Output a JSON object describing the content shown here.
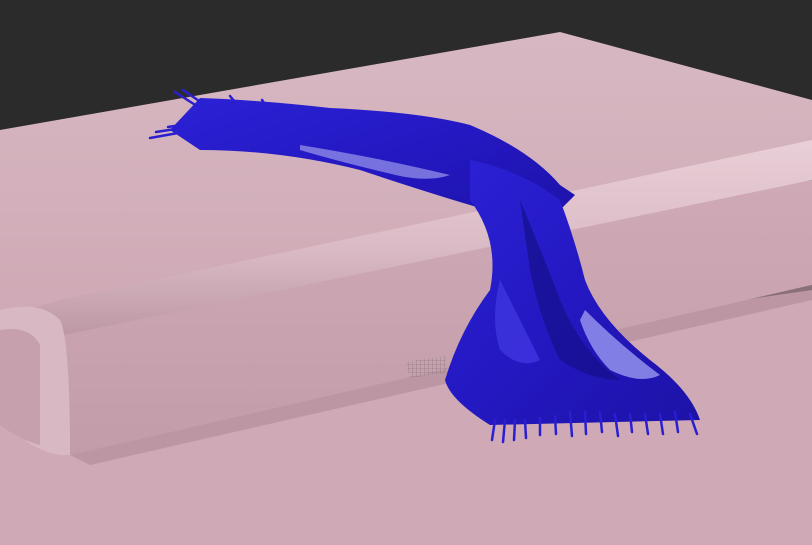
{
  "scene": {
    "background_color": "#2b2b2b",
    "surface_color": "#d3b0bb",
    "surface_light": "#e7c9d2",
    "surface_shadow": "#a98996",
    "cloth_color": "#2a1fd0",
    "cloth_highlight": "#6a6af0",
    "cloth_shadow": "#16107a",
    "grid_color": "#8a7a82"
  }
}
